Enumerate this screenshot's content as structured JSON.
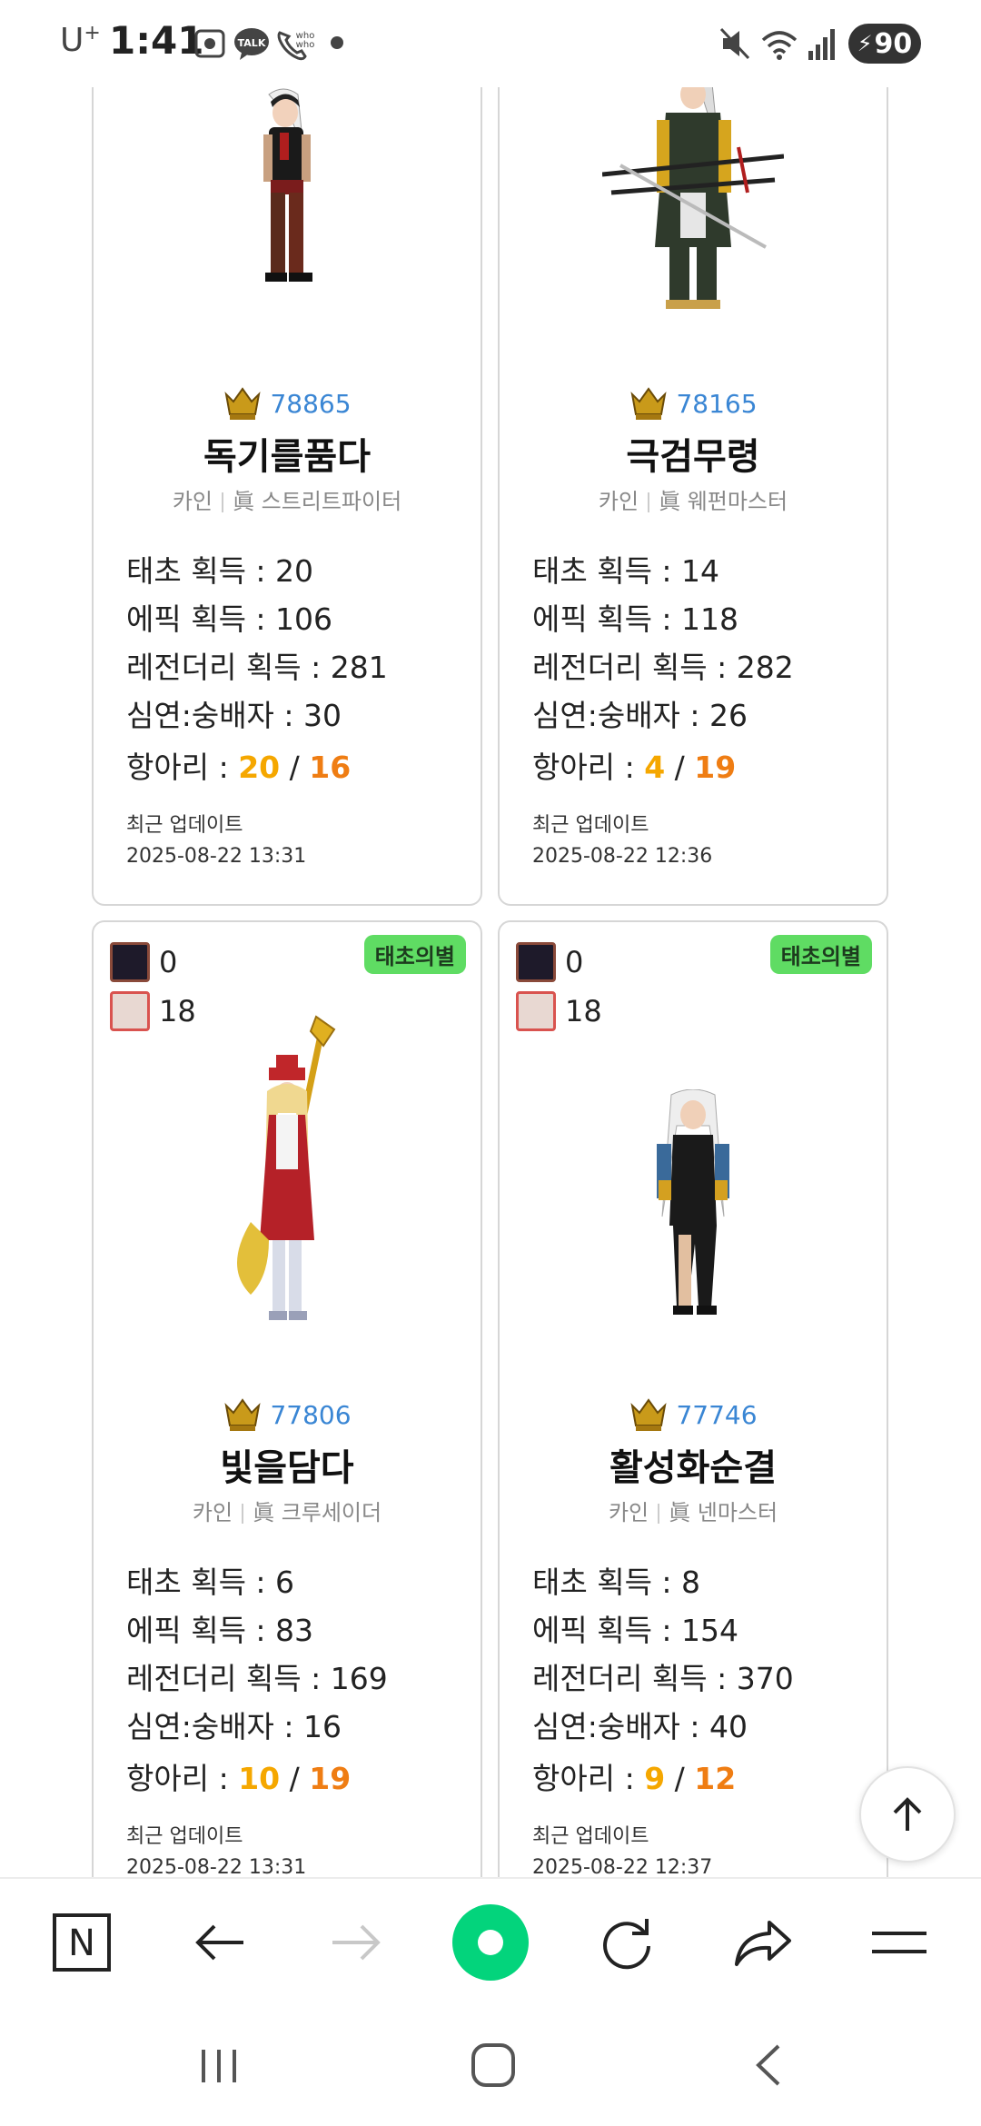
{
  "status_bar": {
    "carrier": "U",
    "carrier_sup": "+",
    "time": "1:41",
    "battery": "90",
    "icons": [
      "screenshot-icon",
      "kakaotalk-icon",
      "whowho-call-icon",
      "mute-icon",
      "wifi-icon",
      "signal-icon",
      "battery-icon"
    ]
  },
  "cards": [
    {
      "rank": "78865",
      "name": "독기를품다",
      "server": "카인",
      "job": "眞 스트리트파이터",
      "stats": [
        {
          "label": "태초 획득",
          "value": "20"
        },
        {
          "label": "에픽 획득",
          "value": "106"
        },
        {
          "label": "레전더리 획득",
          "value": "281"
        },
        {
          "label": "심연:숭배자",
          "value": "30"
        }
      ],
      "hang_label": "항아리",
      "hang_a": "20",
      "hang_b": "16",
      "update_label": "최근 업데이트",
      "update_time": "2025-08-22 13:31"
    },
    {
      "rank": "78165",
      "name": "극검무령",
      "server": "카인",
      "job": "眞 웨펀마스터",
      "stats": [
        {
          "label": "태초 획득",
          "value": "14"
        },
        {
          "label": "에픽 획득",
          "value": "118"
        },
        {
          "label": "레전더리 획득",
          "value": "282"
        },
        {
          "label": "심연:숭배자",
          "value": "26"
        }
      ],
      "hang_label": "항아리",
      "hang_a": "4",
      "hang_b": "19",
      "update_label": "최근 업데이트",
      "update_time": "2025-08-22 12:36"
    },
    {
      "mini_a": "0",
      "mini_b": "18",
      "tag": "태초의별",
      "rank": "77806",
      "name": "빛을담다",
      "server": "카인",
      "job": "眞 크루세이더",
      "stats": [
        {
          "label": "태초 획득",
          "value": "6"
        },
        {
          "label": "에픽 획득",
          "value": "83"
        },
        {
          "label": "레전더리 획득",
          "value": "169"
        },
        {
          "label": "심연:숭배자",
          "value": "16"
        }
      ],
      "hang_label": "항아리",
      "hang_a": "10",
      "hang_b": "19",
      "update_label": "최근 업데이트",
      "update_time": "2025-08-22 13:31"
    },
    {
      "mini_a": "0",
      "mini_b": "18",
      "tag": "태초의별",
      "rank": "77746",
      "name": "활성화순결",
      "server": "카인",
      "job": "眞 넨마스터",
      "stats": [
        {
          "label": "태초 획득",
          "value": "8"
        },
        {
          "label": "에픽 획득",
          "value": "154"
        },
        {
          "label": "레전더리 획득",
          "value": "370"
        },
        {
          "label": "심연:숭배자",
          "value": "40"
        }
      ],
      "hang_label": "항아리",
      "hang_a": "9",
      "hang_b": "12",
      "update_label": "최근 업데이트",
      "update_time": "2025-08-22 12:37"
    }
  ],
  "colors": {
    "rank_blue": "#3a86d4",
    "hang_yellow": "#f5a700",
    "hang_orange": "#ef7d13",
    "tag_green": "#5fdc63",
    "naver_green": "#03d47c"
  },
  "toolbar": {
    "icons": [
      "naver-home-icon",
      "back-arrow-icon",
      "forward-arrow-icon",
      "naver-green-dot-icon",
      "refresh-icon",
      "share-icon",
      "menu-icon"
    ],
    "naver_letter": "N"
  },
  "system_nav": {
    "icons": [
      "recent-apps-icon",
      "home-icon",
      "back-icon"
    ]
  }
}
